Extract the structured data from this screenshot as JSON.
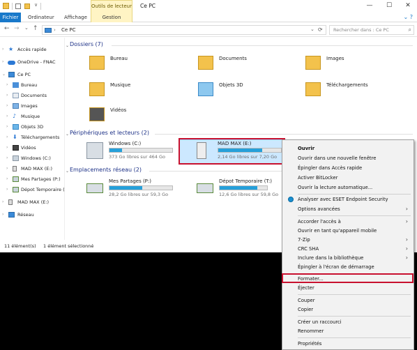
{
  "titlebar": {
    "contextual_tab": "Outils de lecteur",
    "title": "Ce PC",
    "min": "—",
    "max": "☐",
    "close": "✕"
  },
  "tabs": {
    "fichier": "Fichier",
    "ordinateur": "Ordinateur",
    "affichage": "Affichage",
    "gestion": "Gestion"
  },
  "address": {
    "back": "←",
    "forward": "→",
    "recent": "⌄",
    "up": "↑",
    "path": "Ce PC",
    "refresh": "⟳",
    "dropdown": "⌄"
  },
  "search": {
    "placeholder": "Rechercher dans : Ce PC",
    "icon": "⌕"
  },
  "navpane": {
    "items": [
      {
        "label": "Accès rapide"
      },
      {
        "label": "OneDrive - FNAC"
      },
      {
        "label": "Ce PC"
      },
      {
        "label": "Bureau"
      },
      {
        "label": "Documents"
      },
      {
        "label": "Images"
      },
      {
        "label": "Musique"
      },
      {
        "label": "Objets 3D"
      },
      {
        "label": "Téléchargements"
      },
      {
        "label": "Vidéos"
      },
      {
        "label": "Windows (C:)"
      },
      {
        "label": "MAD MAX (E:)"
      },
      {
        "label": "Mes Partages (P:)"
      },
      {
        "label": "Dépot Temporaire ("
      },
      {
        "label": "MAD MAX (E:)"
      },
      {
        "label": "Réseau"
      }
    ]
  },
  "groups": {
    "folders": {
      "title": "Dossiers (7)",
      "items": [
        "Bureau",
        "Documents",
        "Images",
        "Musique",
        "Objets 3D",
        "Téléchargements",
        "Vidéos"
      ]
    },
    "drives": {
      "title": "Périphériques et lecteurs (2)",
      "items": [
        {
          "name": "Windows (C:)",
          "free": "373 Go libres sur 464 Go",
          "used_fraction": 0.2
        },
        {
          "name": "MAD MAX (E:)",
          "free": "2,14 Go libres sur 7,20 Go",
          "used_fraction": 0.7
        }
      ]
    },
    "network": {
      "title": "Emplacements réseau (2)",
      "items": [
        {
          "name": "Mes Partages (P:)",
          "free": "28,2 Go libres sur 59,3 Go",
          "used_fraction": 0.52
        },
        {
          "name": "Dépot Temporaire (T:)",
          "free": "12,6 Go libres sur 59,8 Go",
          "used_fraction": 0.79
        }
      ]
    }
  },
  "status": {
    "count": "11 élément(s)",
    "selected": "1 élément sélectionné"
  },
  "context_menu": {
    "items": [
      "Ouvrir",
      "Ouvrir dans une nouvelle fenêtre",
      "Épingler dans Accès rapide",
      "Activer BitLocker",
      "Ouvrir la lecture automatique...",
      "Analyser avec ESET Endpoint Security",
      "Options avancées",
      "Accorder l'accès à",
      "Ouvrir en tant qu'appareil mobile",
      "7-Zip",
      "CRC SHA",
      "Inclure dans la bibliothèque",
      "Épingler à l'écran de démarrage",
      "Formater...",
      "Éjecter",
      "Couper",
      "Copier",
      "Créer un raccourci",
      "Renommer",
      "Propriétés"
    ],
    "arrow": "›"
  },
  "colors": {
    "accent": "#1979ca",
    "drive_bar": "#26a0da",
    "highlight": "#c8102e",
    "selection": "#cce8ff"
  },
  "icons": [
    "folder-icon",
    "drive-icon",
    "usb-drive-icon",
    "network-drive-icon",
    "pc-icon",
    "star-icon",
    "cloud-icon",
    "network-icon",
    "eset-icon"
  ]
}
